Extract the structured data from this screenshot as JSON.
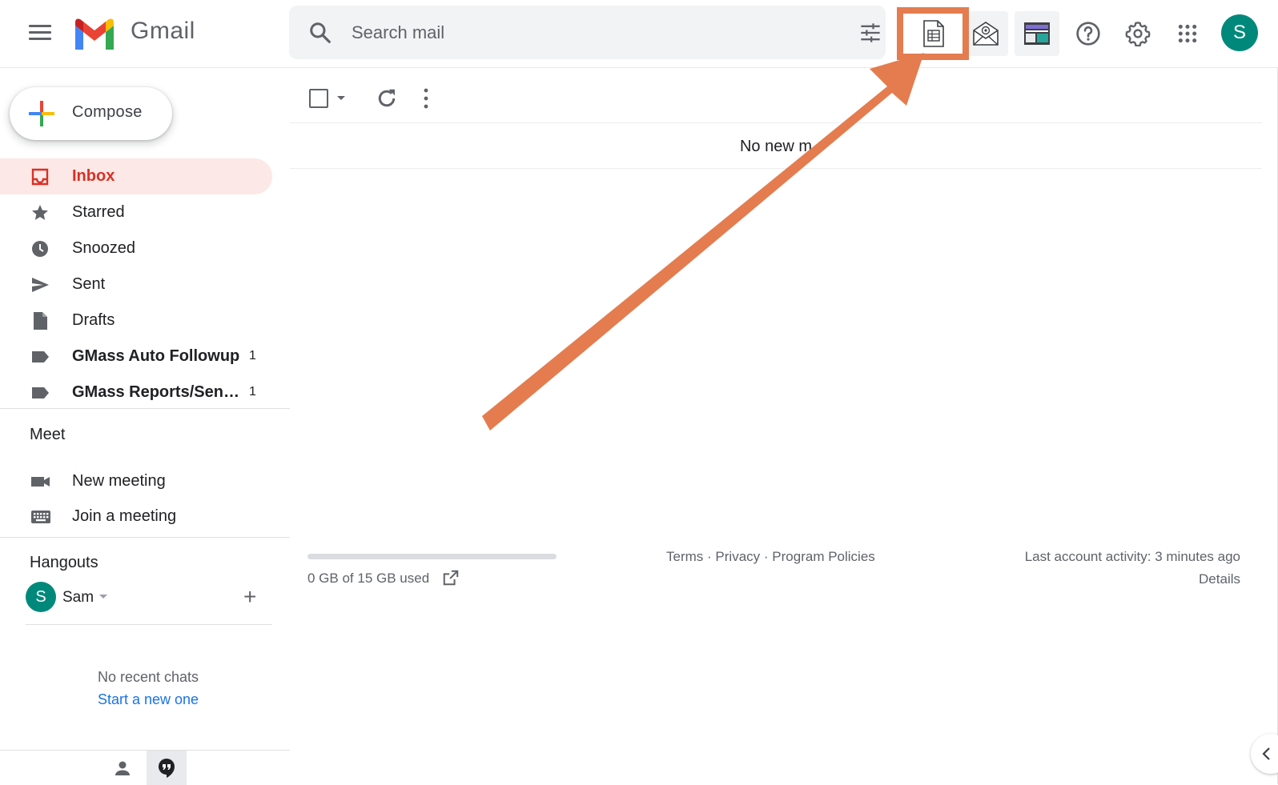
{
  "app": {
    "name": "Gmail"
  },
  "search": {
    "placeholder": "Search mail"
  },
  "header": {
    "avatar_letter": "S"
  },
  "compose": {
    "label": "Compose"
  },
  "nav": [
    {
      "label": "Inbox",
      "icon": "inbox-icon",
      "count": "",
      "active": true
    },
    {
      "label": "Starred",
      "icon": "star-icon",
      "count": ""
    },
    {
      "label": "Snoozed",
      "icon": "clock-icon",
      "count": ""
    },
    {
      "label": "Sent",
      "icon": "send-icon",
      "count": ""
    },
    {
      "label": "Drafts",
      "icon": "draft-icon",
      "count": ""
    },
    {
      "label": "GMass Auto Followup",
      "icon": "label-icon",
      "count": "1"
    },
    {
      "label": "GMass Reports/Sen…",
      "icon": "label-icon",
      "count": "1"
    }
  ],
  "meet": {
    "title": "Meet",
    "items": [
      {
        "label": "New meeting",
        "icon": "video-camera-icon"
      },
      {
        "label": "Join a meeting",
        "icon": "keyboard-icon"
      }
    ]
  },
  "hangouts": {
    "title": "Hangouts",
    "user_initial": "S",
    "user_name": "Sam",
    "no_chats": "No recent chats",
    "start_new": "Start a new one"
  },
  "main": {
    "empty_message": "No new m"
  },
  "footer": {
    "storage_text": "0 GB of 15 GB used",
    "storage_used_fraction": 0.0,
    "terms": "Terms",
    "privacy": "Privacy",
    "policies": "Program Policies",
    "separator": "·",
    "last_activity": "Last account activity: 3 minutes ago",
    "details": "Details"
  },
  "colors": {
    "accent_red": "#d93025",
    "inbox_active_bg": "#fce8e6",
    "annotation_orange": "#e47c4f",
    "avatar_teal": "#00897b",
    "link_blue": "#1a73e8"
  }
}
